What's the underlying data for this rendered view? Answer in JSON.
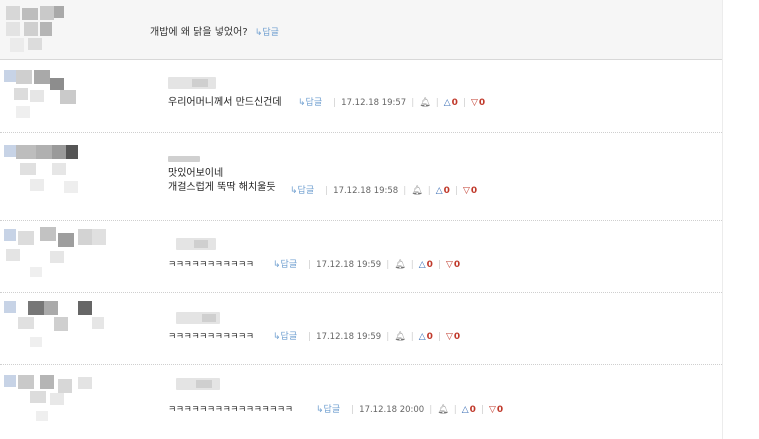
{
  "post": {
    "text": "개밥에 왜 닭을 넣었어?",
    "reply_label": "↳답글"
  },
  "comments": [
    {
      "lines": [
        "우리어머니께서 만드신건데"
      ],
      "reply_label": "↳답글",
      "date": "17.12.18 19:57",
      "report_icon": "bell-icon",
      "likes": "0",
      "dislikes": "0"
    },
    {
      "lines": [
        "맛있어보이네",
        "개걸스럽게 뚝딱 해치울듯"
      ],
      "reply_label": "↳답글",
      "date": "17.12.18 19:58",
      "report_icon": "bell-icon",
      "likes": "0",
      "dislikes": "0"
    },
    {
      "lines": [
        "ㅋㅋㅋㅋㅋㅋㅋㅋㅋㅋㅋ"
      ],
      "reply_label": "↳답글",
      "date": "17.12.18 19:59",
      "report_icon": "bell-icon",
      "likes": "0",
      "dislikes": "0"
    },
    {
      "lines": [
        "ㅋㅋㅋㅋㅋㅋㅋㅋㅋㅋㅋ"
      ],
      "reply_label": "↳답글",
      "date": "17.12.18 19:59",
      "report_icon": "bell-icon",
      "likes": "0",
      "dislikes": "0"
    },
    {
      "lines": [
        "ㅋㅋㅋㅋㅋㅋㅋㅋㅋㅋㅋㅋㅋㅋㅋㅋ"
      ],
      "reply_label": "↳답글",
      "date": "17.12.18 20:00",
      "report_icon": "bell-icon",
      "likes": "0",
      "dislikes": "0"
    }
  ]
}
